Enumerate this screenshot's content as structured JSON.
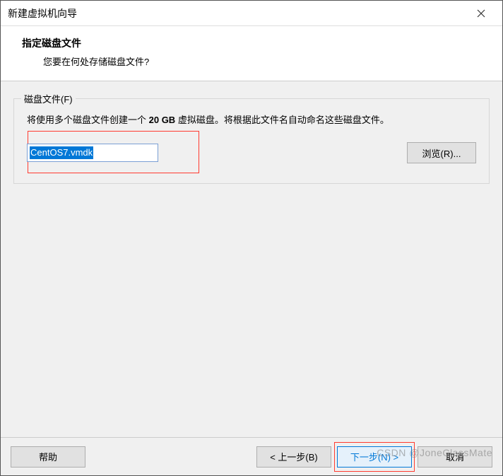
{
  "window": {
    "title": "新建虚拟机向导"
  },
  "header": {
    "title": "指定磁盘文件",
    "subtitle": "您要在何处存储磁盘文件?"
  },
  "group": {
    "legend": "磁盘文件(F)",
    "description_pre": "将使用多个磁盘文件创建一个 ",
    "description_bold": "20 GB",
    "description_post": " 虚拟磁盘。将根据此文件名自动命名这些磁盘文件。",
    "input_value": "CentOS7.vmdk",
    "browse_label": "浏览(R)..."
  },
  "footer": {
    "help": "帮助",
    "back": "< 上一步(B)",
    "next": "下一步(N) >",
    "cancel": "取消"
  },
  "watermark": "CSDN @JoneClassMate"
}
